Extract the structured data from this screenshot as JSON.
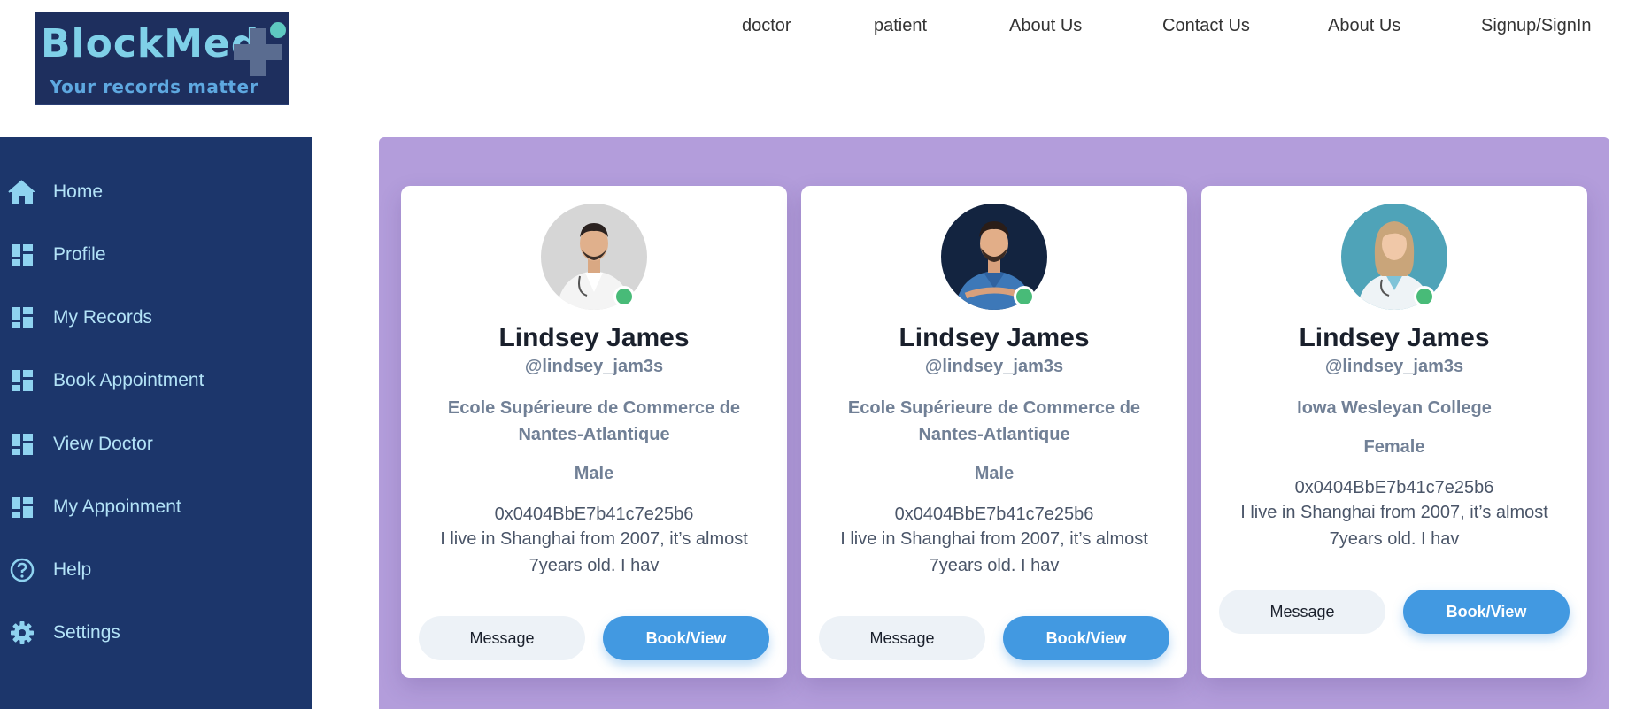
{
  "logo": {
    "title": "BlockMed",
    "tagline": "Your records matter"
  },
  "nav": {
    "items": [
      "doctor",
      "patient",
      "About Us",
      "Contact Us",
      "About Us",
      "Signup/SignIn"
    ]
  },
  "sidebar": {
    "items": [
      {
        "label": "Home",
        "icon": "home-icon"
      },
      {
        "label": "Profile",
        "icon": "dashboard-icon"
      },
      {
        "label": "My Records",
        "icon": "dashboard-icon"
      },
      {
        "label": "Book Appointment",
        "icon": "dashboard-icon"
      },
      {
        "label": "View Doctor",
        "icon": "dashboard-icon"
      },
      {
        "label": "My Appoinment",
        "icon": "dashboard-icon"
      },
      {
        "label": "Help",
        "icon": "help-icon"
      },
      {
        "label": "Settings",
        "icon": "gear-icon"
      }
    ]
  },
  "cards": [
    {
      "name": "Lindsey James",
      "handle": "@lindsey_jam3s",
      "school": "Ecole Supérieure de Commerce de Nantes-Atlantique",
      "gender": "Male",
      "address": "0x0404BbE7b41c7e25b6",
      "bio": "I live in Shanghai from 2007, it’s almost 7years old. I hav",
      "message_label": "Message",
      "book_label": "Book/View"
    },
    {
      "name": "Lindsey James",
      "handle": "@lindsey_jam3s",
      "school": "Ecole Supérieure de Commerce de Nantes-Atlantique",
      "gender": "Male",
      "address": "0x0404BbE7b41c7e25b6",
      "bio": "I live in Shanghai from 2007, it’s almost 7years old. I hav",
      "message_label": "Message",
      "book_label": "Book/View"
    },
    {
      "name": "Lindsey James",
      "handle": "@lindsey_jam3s",
      "school": "Iowa Wesleyan College",
      "gender": "Female",
      "address": "0x0404BbE7b41c7e25b6",
      "bio": "I live in Shanghai from 2007, it’s almost 7years old. I hav",
      "message_label": "Message",
      "book_label": "Book/View"
    }
  ],
  "colors": {
    "sidebar_bg": "#1c366b",
    "sidebar_text": "#b3e3f7",
    "panel_bg": "#b39ddb",
    "primary_button": "#4299e1",
    "online_status": "#48bb78"
  }
}
